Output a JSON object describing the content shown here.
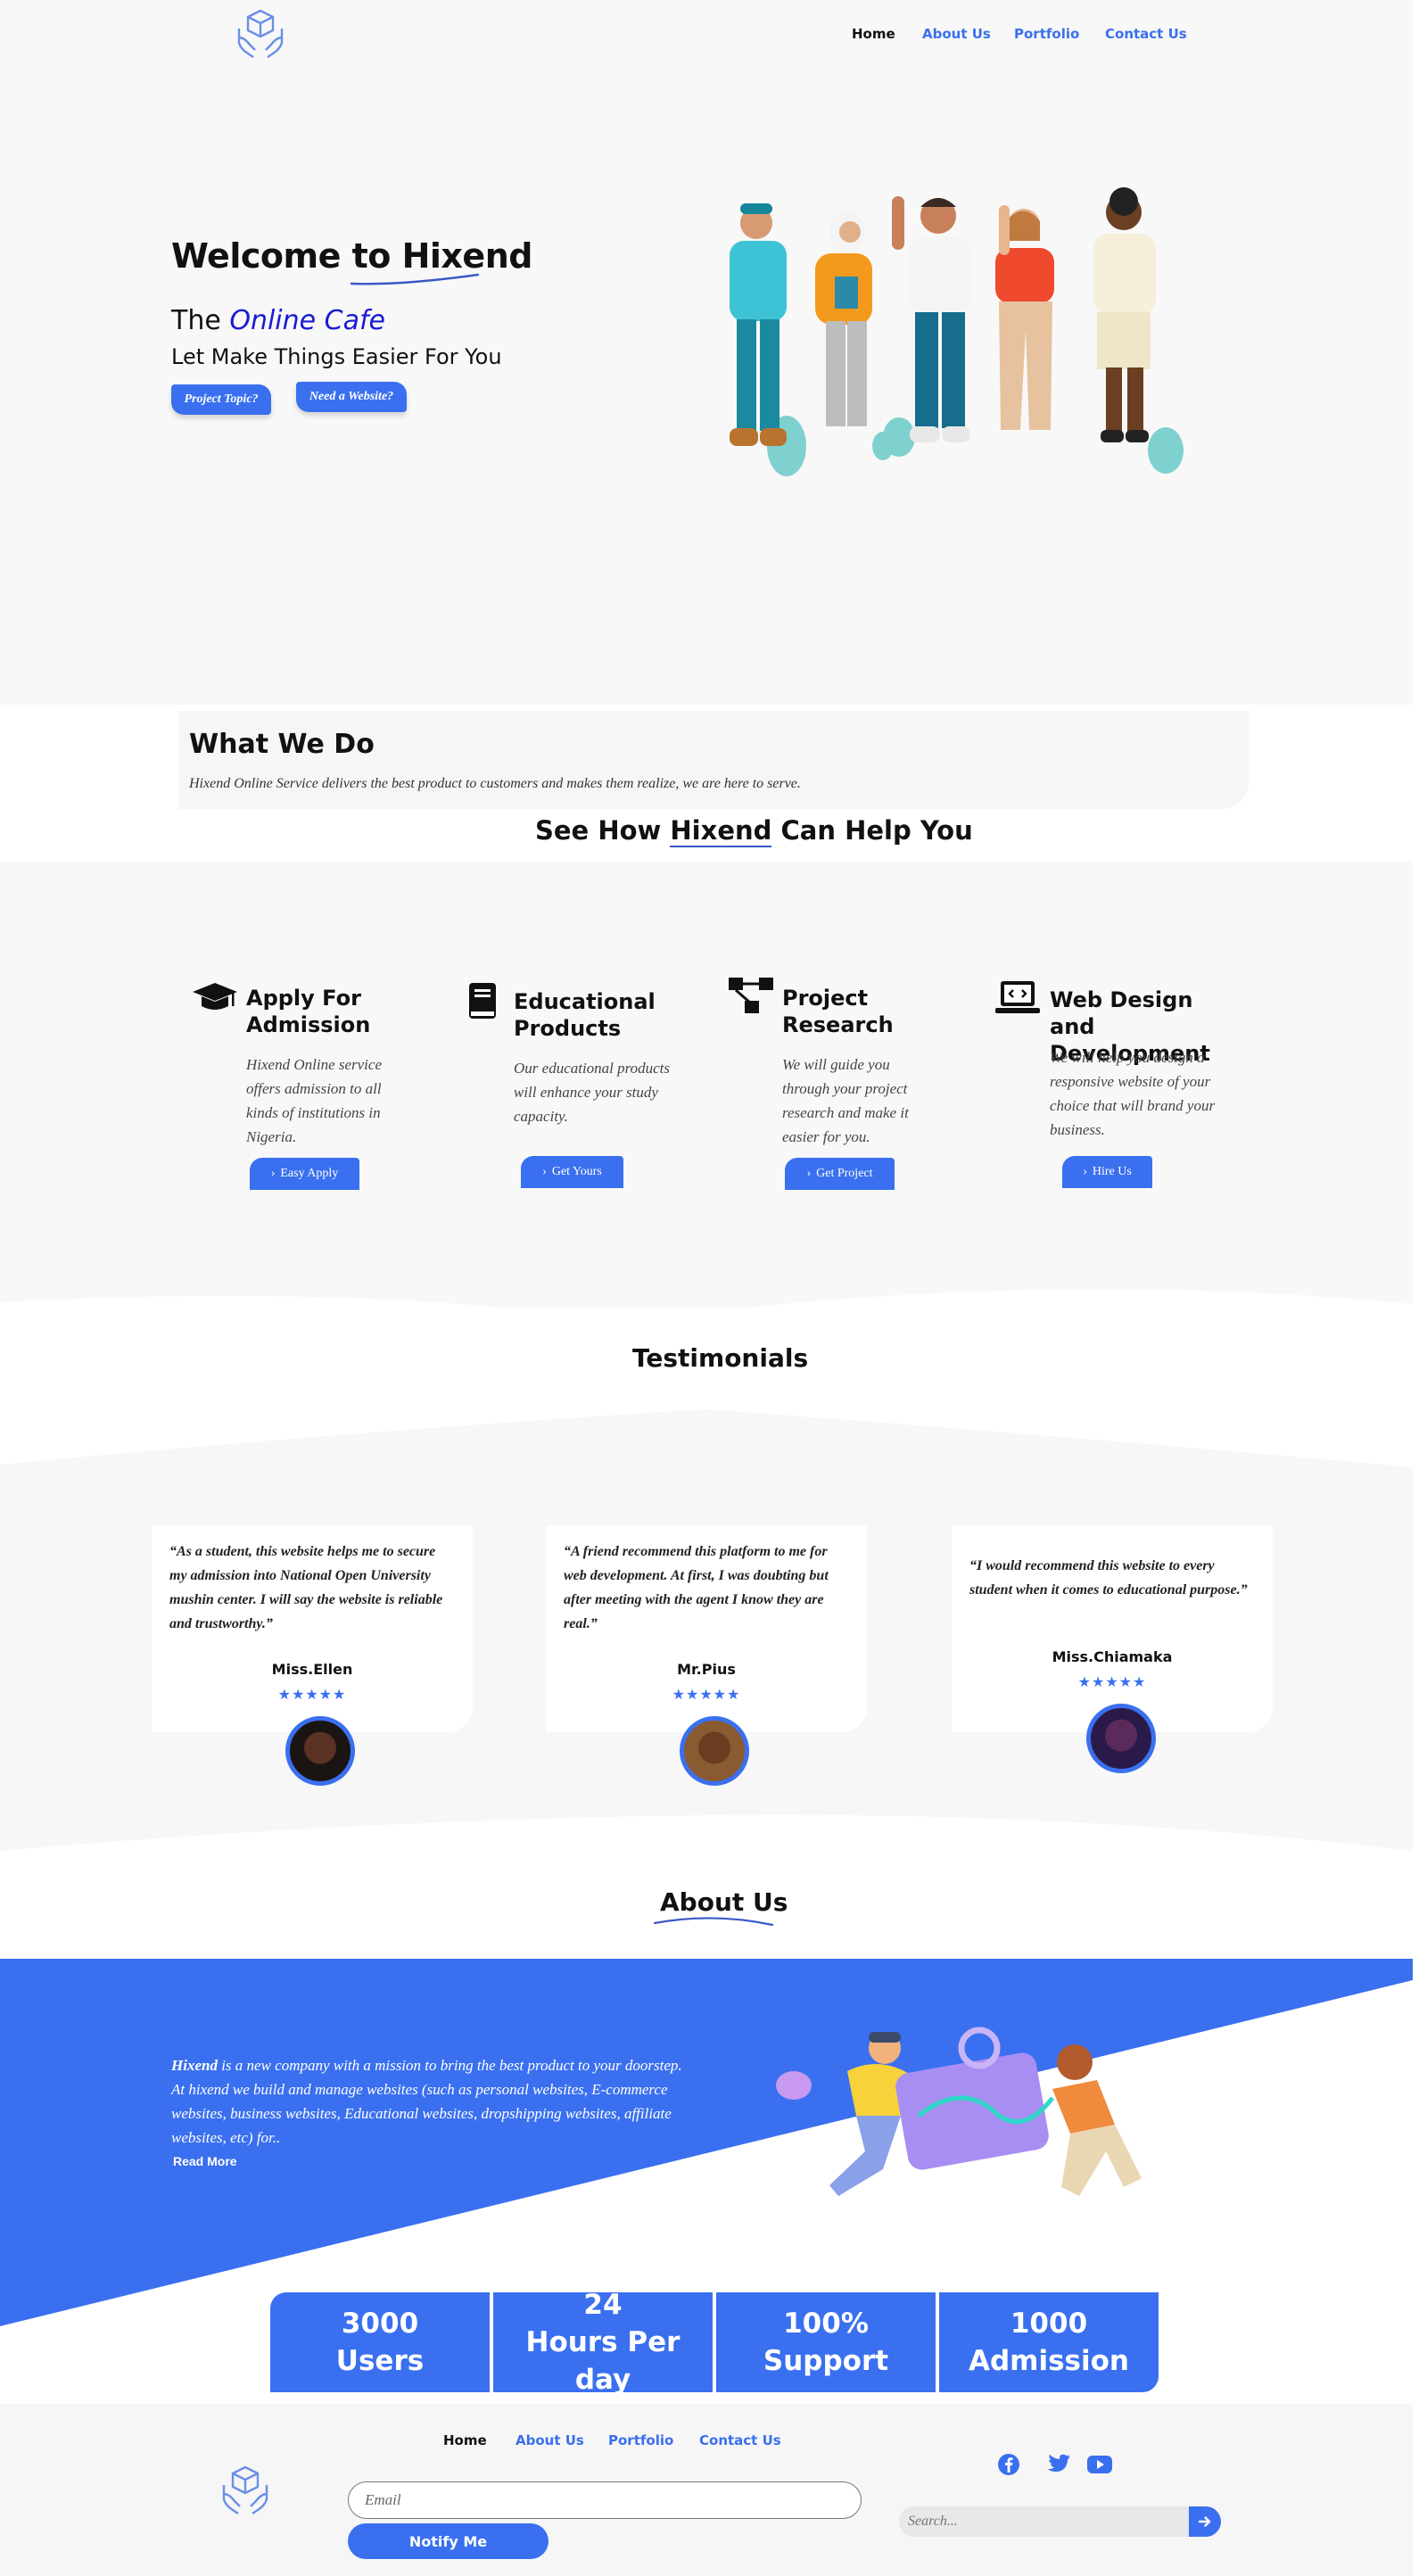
{
  "nav": {
    "items": [
      {
        "label": "Home",
        "active": true
      },
      {
        "label": "About Us",
        "active": false
      },
      {
        "label": "Portfolio",
        "active": false
      },
      {
        "label": "Contact Us",
        "active": false
      }
    ]
  },
  "hero": {
    "title_prefix": "Welcome to ",
    "title_brand": "Hixend",
    "sub1_prefix": "The ",
    "sub1_highlight": "Online Cafe",
    "sub2": "Let Make Things Easier For You",
    "buttons": [
      "Project Topic?",
      "Need a Website?"
    ]
  },
  "what_we_do": {
    "title": "What We Do",
    "text": "Hixend Online Service delivers the best product to customers and makes them realize, we are here to serve."
  },
  "help": {
    "prefix": "See How ",
    "brand": "Hixend",
    "suffix": " Can Help You"
  },
  "services": [
    {
      "icon": "graduation-cap-icon",
      "title": "Apply For Admission",
      "desc": "Hixend Online service offers admission to all kinds of institutions in Nigeria.",
      "button": "Easy Apply"
    },
    {
      "icon": "book-icon",
      "title": "Educational Products",
      "desc": "Our educational products will enhance your study capacity.",
      "button": "Get Yours"
    },
    {
      "icon": "project-diagram-icon",
      "title": "Project Research",
      "desc": "We will guide you through your project research and make it easier for you.",
      "button": "Get Project"
    },
    {
      "icon": "laptop-code-icon",
      "title": "Web Design and Development",
      "desc": "We will help you design a responsive website of your choice that will brand your business.",
      "button": "Hire Us"
    }
  ],
  "testimonials": {
    "title": "Testimonials",
    "items": [
      {
        "quote": "“As a student, this website helps me to secure my admission into National Open University mushin center. I will say the website is reliable and trustworthy.”",
        "name": "Miss.Ellen",
        "stars": "★★★★★",
        "rating": 5
      },
      {
        "quote": "“A friend recommend this platform to me for web development. At first, I was doubting  but after meeting with the agent I know they are real.”",
        "name": "Mr.Pius",
        "stars": "★★★★★",
        "rating": 5
      },
      {
        "quote": "“I would recommend this website to every student when it comes to educational purpose.”",
        "name": "Miss.Chiamaka",
        "stars": "★★★★★",
        "rating": 5
      }
    ]
  },
  "about": {
    "title": "About Us",
    "brand": "Hixend",
    "text": " is a new company with a mission to bring the best product to your doorstep. At hixend we build and manage websites (such as personal websites, E-commerce websites, business websites, Educational websites, dropshipping websites, affiliate websites, etc)  for..",
    "read_more": "Read More"
  },
  "stats": [
    {
      "value": "3000",
      "label": "Users"
    },
    {
      "value": "24",
      "label": "Hours Per day"
    },
    {
      "value": "100%",
      "label": "Support"
    },
    {
      "value": "1000",
      "label": "Admission"
    }
  ],
  "footer": {
    "nav": [
      "Home",
      "About Us",
      "Portfolio",
      "Contact Us"
    ],
    "email_placeholder": "Email",
    "notify_label": "Notify Me",
    "search_placeholder": "Search...",
    "social": [
      "facebook-icon",
      "twitter-icon",
      "youtube-icon"
    ]
  },
  "colors": {
    "accent": "#3a70ef",
    "cafe": "#1a1ad6",
    "bg": "#f8f8f8"
  }
}
